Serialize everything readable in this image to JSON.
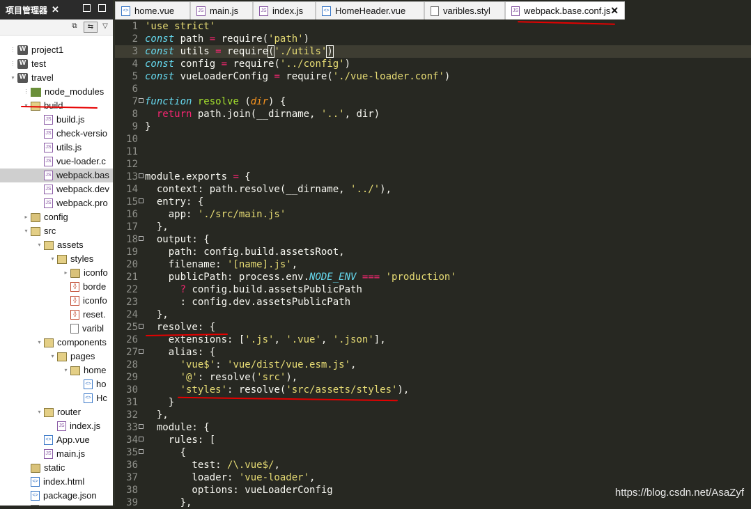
{
  "sidebar": {
    "title": "项目管理器",
    "close": "✕",
    "tree": [
      {
        "label": "project1",
        "type": "proj",
        "depth": 0,
        "tw": "⋮"
      },
      {
        "label": "test",
        "type": "proj",
        "depth": 0,
        "tw": "⋮"
      },
      {
        "label": "travel",
        "type": "proj",
        "depth": 0,
        "tw": "▾"
      },
      {
        "label": "node_modules",
        "type": "nm",
        "depth": 1,
        "tw": "⋮"
      },
      {
        "label": "build",
        "type": "folder-open",
        "depth": 1,
        "tw": "▾"
      },
      {
        "label": "build.js",
        "type": "js",
        "depth": 2,
        "tw": ""
      },
      {
        "label": "check-versio",
        "type": "js",
        "depth": 2,
        "tw": ""
      },
      {
        "label": "utils.js",
        "type": "js",
        "depth": 2,
        "tw": ""
      },
      {
        "label": "vue-loader.c",
        "type": "js",
        "depth": 2,
        "tw": ""
      },
      {
        "label": "webpack.bas",
        "type": "js",
        "depth": 2,
        "tw": "",
        "selected": true
      },
      {
        "label": "webpack.dev",
        "type": "js",
        "depth": 2,
        "tw": ""
      },
      {
        "label": "webpack.pro",
        "type": "js",
        "depth": 2,
        "tw": ""
      },
      {
        "label": "config",
        "type": "folder",
        "depth": 1,
        "tw": "▸"
      },
      {
        "label": "src",
        "type": "folder-open",
        "depth": 1,
        "tw": "▾"
      },
      {
        "label": "assets",
        "type": "folder-open",
        "depth": 2,
        "tw": "▾"
      },
      {
        "label": "styles",
        "type": "folder-open",
        "depth": 3,
        "tw": "▾"
      },
      {
        "label": "iconfo",
        "type": "folder",
        "depth": 4,
        "tw": "▸"
      },
      {
        "label": "borde",
        "type": "css",
        "depth": 4,
        "tw": ""
      },
      {
        "label": "iconfo",
        "type": "css",
        "depth": 4,
        "tw": ""
      },
      {
        "label": "reset.",
        "type": "css",
        "depth": 4,
        "tw": ""
      },
      {
        "label": "varibl",
        "type": "txt",
        "depth": 4,
        "tw": ""
      },
      {
        "label": "components",
        "type": "folder-open",
        "depth": 2,
        "tw": "▾"
      },
      {
        "label": "pages",
        "type": "folder-open",
        "depth": 3,
        "tw": "▾"
      },
      {
        "label": "home",
        "type": "folder-open",
        "depth": 4,
        "tw": "▾"
      },
      {
        "label": "ho",
        "type": "vue",
        "depth": 5,
        "tw": ""
      },
      {
        "label": "Hc",
        "type": "vue",
        "depth": 5,
        "tw": ""
      },
      {
        "label": "router",
        "type": "folder-open",
        "depth": 2,
        "tw": "▾"
      },
      {
        "label": "index.js",
        "type": "js",
        "depth": 3,
        "tw": ""
      },
      {
        "label": "App.vue",
        "type": "vue",
        "depth": 2,
        "tw": ""
      },
      {
        "label": "main.js",
        "type": "js",
        "depth": 2,
        "tw": ""
      },
      {
        "label": "static",
        "type": "folder",
        "depth": 1,
        "tw": ""
      },
      {
        "label": "index.html",
        "type": "vue",
        "depth": 1,
        "tw": ""
      },
      {
        "label": "package.json",
        "type": "vue",
        "depth": 1,
        "tw": ""
      },
      {
        "label": "README.md",
        "type": "txt",
        "depth": 1,
        "tw": ""
      }
    ]
  },
  "tabs": [
    {
      "label": "home.vue",
      "icon": "vue"
    },
    {
      "label": "main.js",
      "icon": "js"
    },
    {
      "label": "index.js",
      "icon": "js"
    },
    {
      "label": "HomeHeader.vue",
      "icon": "vue"
    },
    {
      "label": "varibles.styl",
      "icon": "txt"
    },
    {
      "label": "webpack.base.conf.js",
      "icon": "js",
      "active": true,
      "close": "✕"
    }
  ],
  "code_lines": [
    {
      "n": "1",
      "fold": false,
      "tokens": [
        [
          "s",
          "'use strict'"
        ]
      ]
    },
    {
      "n": "2",
      "fold": false,
      "tokens": [
        [
          "k",
          "const"
        ],
        [
          "t",
          " path "
        ],
        [
          "o",
          "="
        ],
        [
          "t",
          " require("
        ],
        [
          "s",
          "'path'"
        ],
        [
          "t",
          ")"
        ]
      ]
    },
    {
      "n": "3",
      "fold": false,
      "hl": true,
      "tokens": [
        [
          "k",
          "const"
        ],
        [
          "t",
          " utils "
        ],
        [
          "o",
          "="
        ],
        [
          "t",
          " require"
        ],
        [
          "bm",
          "("
        ],
        [
          "s",
          "'./utils'"
        ],
        [
          "bm",
          ")"
        ],
        [
          "cur",
          ""
        ]
      ]
    },
    {
      "n": "4",
      "fold": false,
      "tokens": [
        [
          "k",
          "const"
        ],
        [
          "t",
          " config "
        ],
        [
          "o",
          "="
        ],
        [
          "t",
          " require("
        ],
        [
          "s",
          "'../config'"
        ],
        [
          "t",
          ")"
        ]
      ]
    },
    {
      "n": "5",
      "fold": false,
      "tokens": [
        [
          "k",
          "const"
        ],
        [
          "t",
          " vueLoaderConfig "
        ],
        [
          "o",
          "="
        ],
        [
          "t",
          " require("
        ],
        [
          "s",
          "'./vue-loader.conf'"
        ],
        [
          "t",
          ")"
        ]
      ]
    },
    {
      "n": "6",
      "fold": false,
      "tokens": []
    },
    {
      "n": "7",
      "fold": true,
      "tokens": [
        [
          "k",
          "function"
        ],
        [
          "t",
          " "
        ],
        [
          "p",
          "resolve"
        ],
        [
          "t",
          " ("
        ],
        [
          "pa",
          "dir"
        ],
        [
          "t",
          ") {"
        ]
      ]
    },
    {
      "n": "8",
      "fold": false,
      "tokens": [
        [
          "t",
          "  "
        ],
        [
          "o",
          "return"
        ],
        [
          "t",
          " path.join(__dirname, "
        ],
        [
          "s",
          "'..'"
        ],
        [
          "t",
          ", dir)"
        ]
      ]
    },
    {
      "n": "9",
      "fold": false,
      "tokens": [
        [
          "t",
          "}"
        ]
      ]
    },
    {
      "n": "10",
      "fold": false,
      "tokens": []
    },
    {
      "n": "11",
      "fold": false,
      "tokens": []
    },
    {
      "n": "12",
      "fold": false,
      "tokens": []
    },
    {
      "n": "13",
      "fold": true,
      "tokens": [
        [
          "t",
          "module.exports "
        ],
        [
          "o",
          "="
        ],
        [
          "t",
          " {"
        ]
      ]
    },
    {
      "n": "14",
      "fold": false,
      "tokens": [
        [
          "t",
          "  context: path.resolve(__dirname, "
        ],
        [
          "s",
          "'../'"
        ],
        [
          "t",
          "),"
        ]
      ]
    },
    {
      "n": "15",
      "fold": true,
      "tokens": [
        [
          "t",
          "  entry: {"
        ]
      ]
    },
    {
      "n": "16",
      "fold": false,
      "tokens": [
        [
          "t",
          "    app: "
        ],
        [
          "s",
          "'./src/main.js'"
        ]
      ]
    },
    {
      "n": "17",
      "fold": false,
      "tokens": [
        [
          "t",
          "  },"
        ]
      ]
    },
    {
      "n": "18",
      "fold": true,
      "tokens": [
        [
          "t",
          "  output: {"
        ]
      ]
    },
    {
      "n": "19",
      "fold": false,
      "tokens": [
        [
          "t",
          "    path: config.build.assetsRoot,"
        ]
      ]
    },
    {
      "n": "20",
      "fold": false,
      "tokens": [
        [
          "t",
          "    filename: "
        ],
        [
          "s",
          "'[name].js'"
        ],
        [
          "t",
          ","
        ]
      ]
    },
    {
      "n": "21",
      "fold": false,
      "tokens": [
        [
          "t",
          "    publicPath: process.env."
        ],
        [
          "k2",
          "NODE_ENV"
        ],
        [
          "t",
          " "
        ],
        [
          "o",
          "==="
        ],
        [
          "t",
          " "
        ],
        [
          "s",
          "'production'"
        ]
      ]
    },
    {
      "n": "22",
      "fold": false,
      "tokens": [
        [
          "t",
          "      "
        ],
        [
          "o",
          "?"
        ],
        [
          "t",
          " config.build.assetsPublicPath"
        ]
      ]
    },
    {
      "n": "23",
      "fold": false,
      "tokens": [
        [
          "t",
          "      : config.dev.assetsPublicPath"
        ]
      ]
    },
    {
      "n": "24",
      "fold": false,
      "tokens": [
        [
          "t",
          "  },"
        ]
      ]
    },
    {
      "n": "25",
      "fold": true,
      "tokens": [
        [
          "t",
          "  resolve: {"
        ]
      ]
    },
    {
      "n": "26",
      "fold": false,
      "tokens": [
        [
          "t",
          "    extensions: ["
        ],
        [
          "s",
          "'.js'"
        ],
        [
          "t",
          ", "
        ],
        [
          "s",
          "'.vue'"
        ],
        [
          "t",
          ", "
        ],
        [
          "s",
          "'.json'"
        ],
        [
          "t",
          "],"
        ]
      ]
    },
    {
      "n": "27",
      "fold": true,
      "tokens": [
        [
          "t",
          "    alias: {"
        ]
      ]
    },
    {
      "n": "28",
      "fold": false,
      "tokens": [
        [
          "t",
          "      "
        ],
        [
          "s",
          "'vue$'"
        ],
        [
          "t",
          ": "
        ],
        [
          "s",
          "'vue/dist/vue.esm.js'"
        ],
        [
          "t",
          ","
        ]
      ]
    },
    {
      "n": "29",
      "fold": false,
      "tokens": [
        [
          "t",
          "      "
        ],
        [
          "s",
          "'@'"
        ],
        [
          "t",
          ": resolve("
        ],
        [
          "s",
          "'src'"
        ],
        [
          "t",
          "),"
        ]
      ]
    },
    {
      "n": "30",
      "fold": false,
      "tokens": [
        [
          "t",
          "      "
        ],
        [
          "s",
          "'styles'"
        ],
        [
          "t",
          ": resolve("
        ],
        [
          "s",
          "'src/assets/styles'"
        ],
        [
          "t",
          "),"
        ]
      ]
    },
    {
      "n": "31",
      "fold": false,
      "tokens": [
        [
          "t",
          "    }"
        ]
      ]
    },
    {
      "n": "32",
      "fold": false,
      "tokens": [
        [
          "t",
          "  },"
        ]
      ]
    },
    {
      "n": "33",
      "fold": true,
      "tokens": [
        [
          "t",
          "  module: {"
        ]
      ]
    },
    {
      "n": "34",
      "fold": true,
      "tokens": [
        [
          "t",
          "    rules: ["
        ]
      ]
    },
    {
      "n": "35",
      "fold": true,
      "tokens": [
        [
          "t",
          "      {"
        ]
      ]
    },
    {
      "n": "36",
      "fold": false,
      "tokens": [
        [
          "t",
          "        test: "
        ],
        [
          "s",
          "/\\.vue$/"
        ],
        [
          "t",
          ","
        ]
      ]
    },
    {
      "n": "37",
      "fold": false,
      "tokens": [
        [
          "t",
          "        loader: "
        ],
        [
          "s",
          "'vue-loader'"
        ],
        [
          "t",
          ","
        ]
      ]
    },
    {
      "n": "38",
      "fold": false,
      "tokens": [
        [
          "t",
          "        options: vueLoaderConfig"
        ]
      ]
    },
    {
      "n": "39",
      "fold": false,
      "tokens": [
        [
          "t",
          "      },"
        ]
      ]
    }
  ],
  "watermark": "https://blog.csdn.net/AsaZyf",
  "colors": {
    "editor_bg": "#272822",
    "annotation_red": "#e60000",
    "selected_row": "#cfcfcf"
  }
}
